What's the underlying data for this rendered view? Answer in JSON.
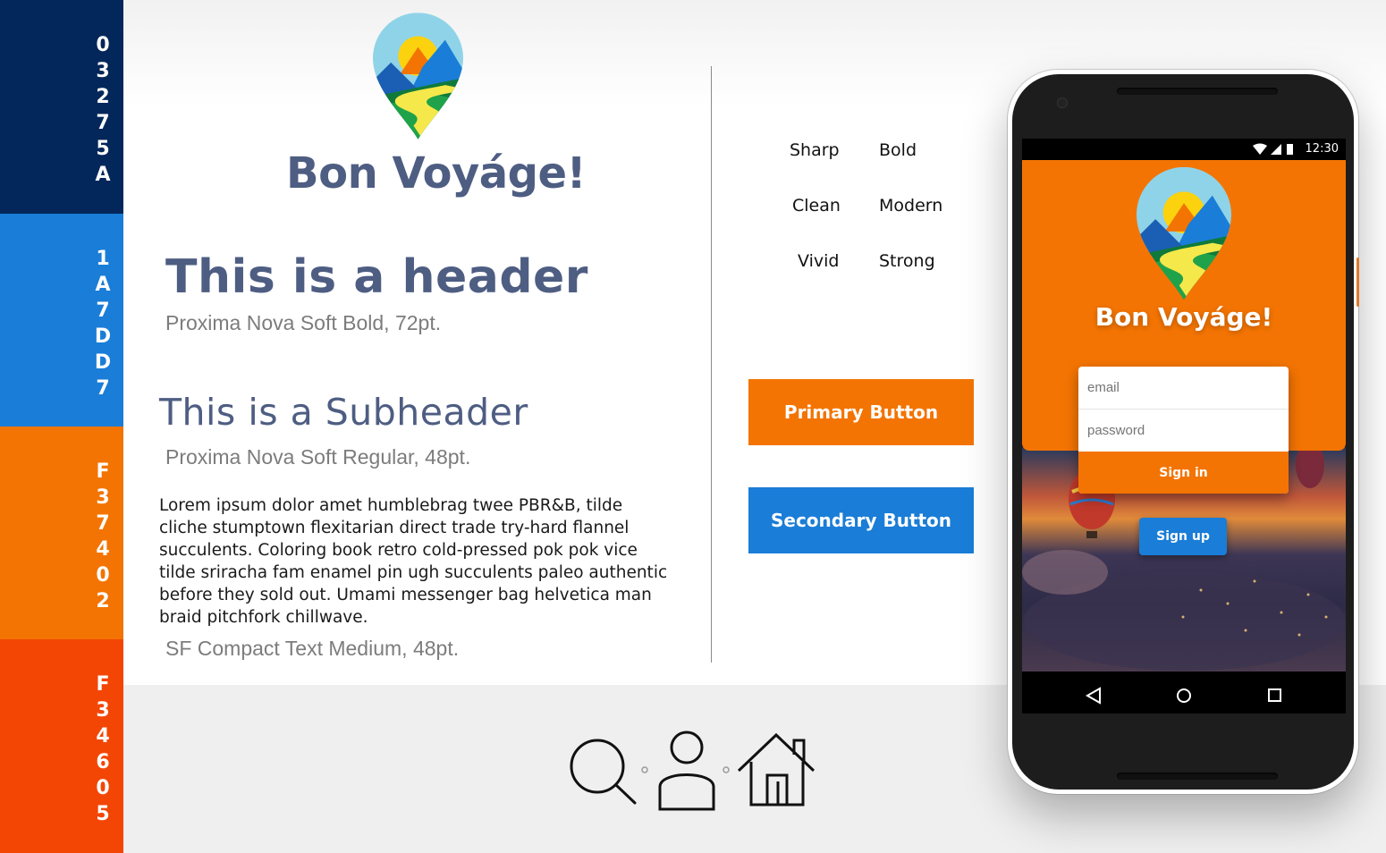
{
  "palette": [
    {
      "code": "03275A",
      "color": "#03275a"
    },
    {
      "code": "1A7DD7",
      "color": "#1a7dd7"
    },
    {
      "code": "F37402",
      "color": "#f37402"
    },
    {
      "code": "F34605",
      "color": "#f34605"
    }
  ],
  "brand": {
    "title": "Bon Voyáge!"
  },
  "typography": {
    "header": "This is a header",
    "header_caption": "Proxima Nova Soft Bold, 72pt.",
    "subheader": "This is a Subheader",
    "subheader_caption": "Proxima Nova Soft Regular, 48pt.",
    "body": "Lorem ipsum dolor amet humblebrag twee PBR&B, tilde cliche stumptown flexitarian direct trade try-hard flannel succulents. Coloring book retro cold-pressed pok pok vice tilde sriracha fam enamel pin ugh succulents paleo authentic before they sold out. Umami messenger bag helvetica man braid pitchfork chillwave.",
    "body_caption": "SF Compact Text Medium, 48pt."
  },
  "keywords": [
    "Sharp",
    "Bold",
    "Clean",
    "Modern",
    "Vivid",
    "Strong"
  ],
  "buttons": {
    "primary": "Primary Button",
    "secondary": "Secondary Button",
    "primary_color": "#f37402",
    "secondary_color": "#1a7dd7"
  },
  "icons": [
    "search-icon",
    "user-icon",
    "home-icon"
  ],
  "phone": {
    "time": "12:30",
    "app_title": "Bon Voyáge!",
    "email_placeholder": "email",
    "password_placeholder": "password",
    "signin_label": "Sign in",
    "signup_label": "Sign up"
  }
}
